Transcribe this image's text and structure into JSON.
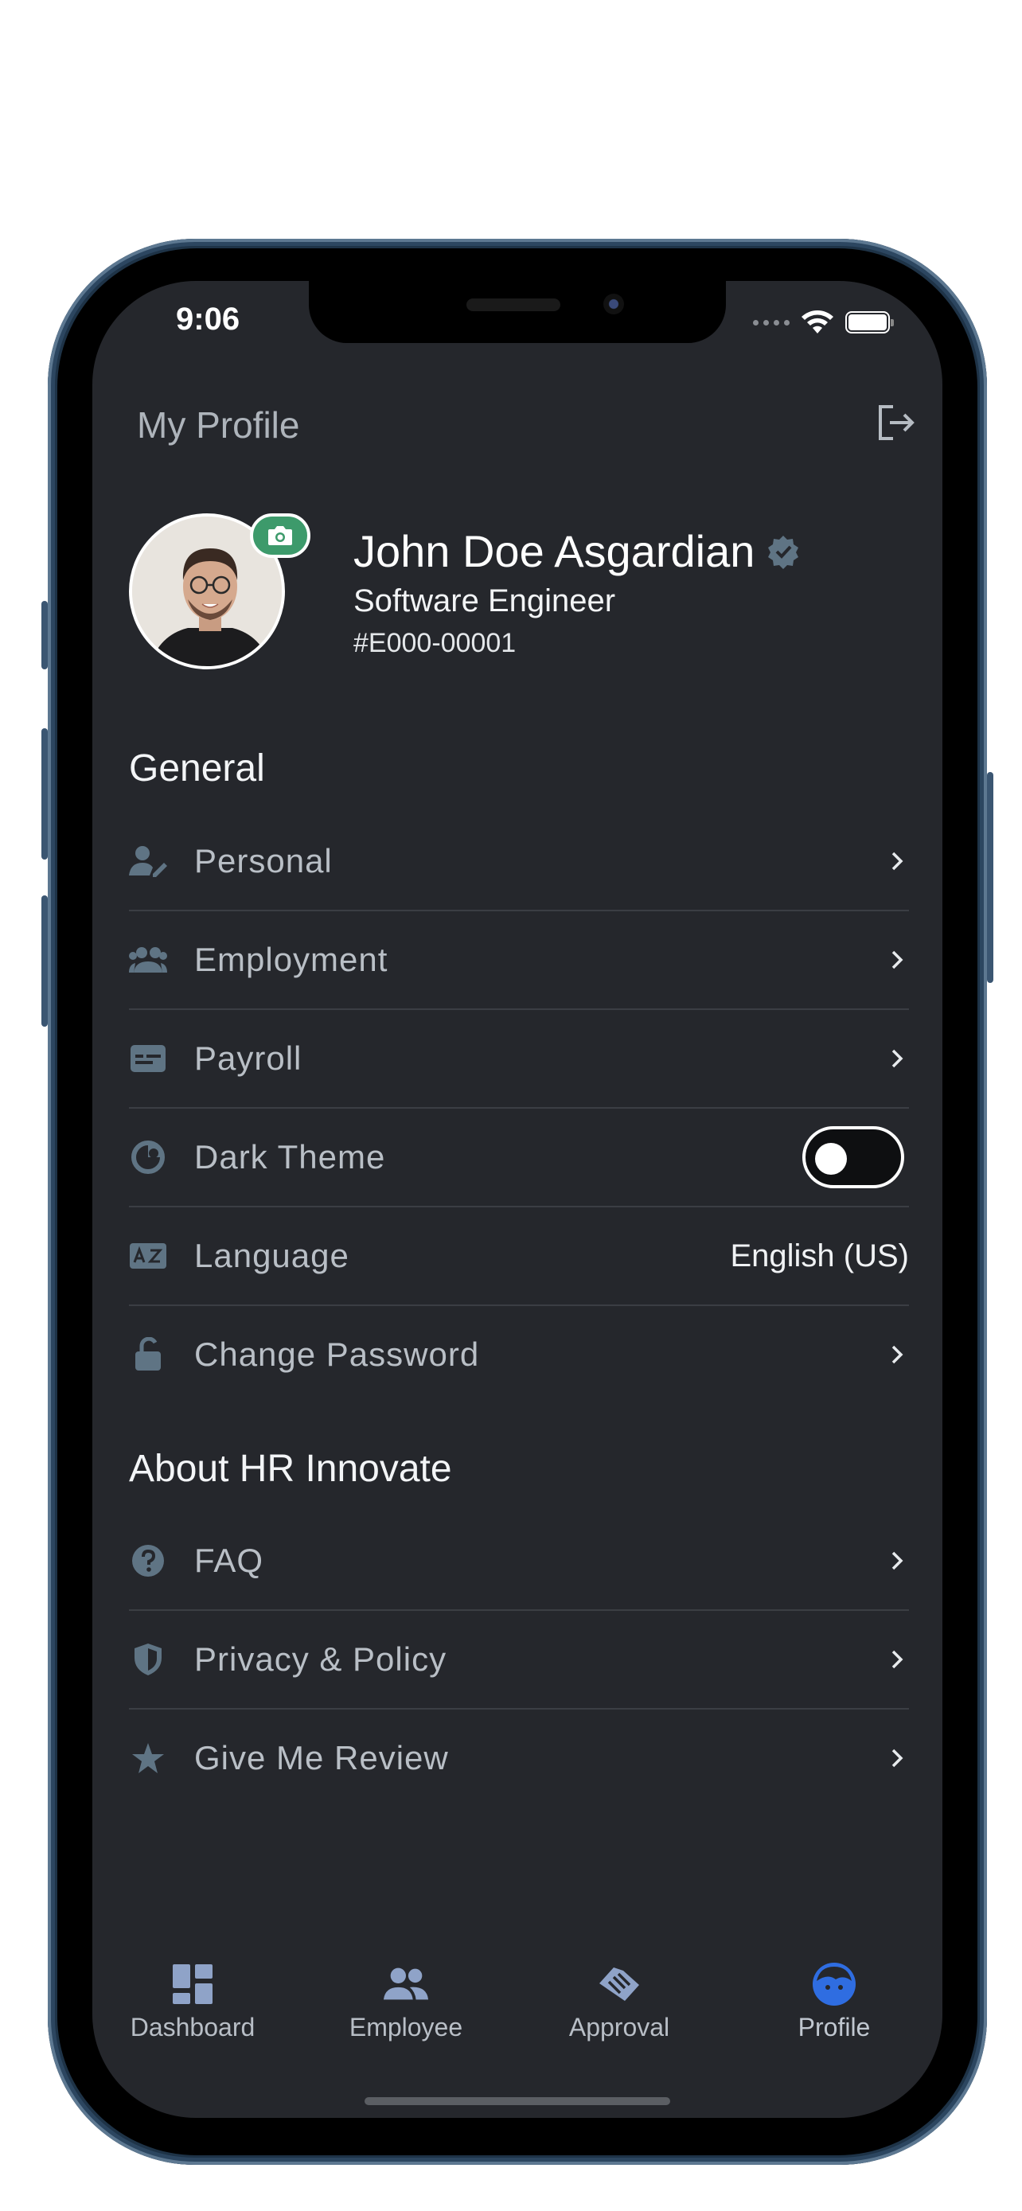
{
  "status_bar": {
    "time": "9:06"
  },
  "header": {
    "title": "My Profile"
  },
  "profile": {
    "name": "John Doe Asgardian",
    "role": "Software Engineer",
    "employee_id": "#E000-00001"
  },
  "general": {
    "title": "General",
    "items": [
      {
        "label": "Personal",
        "icon": "user-edit-icon"
      },
      {
        "label": "Employment",
        "icon": "people-group-icon"
      },
      {
        "label": "Payroll",
        "icon": "payroll-card-icon"
      },
      {
        "label": "Dark Theme",
        "icon": "theme-icon",
        "toggle": false
      },
      {
        "label": "Language",
        "icon": "language-icon",
        "value": "English (US)"
      },
      {
        "label": "Change Password",
        "icon": "lock-open-icon"
      }
    ]
  },
  "about": {
    "title": "About HR Innovate",
    "items": [
      {
        "label": "FAQ",
        "icon": "question-icon"
      },
      {
        "label": "Privacy & Policy",
        "icon": "shield-icon"
      },
      {
        "label": "Give Me Review",
        "icon": "star-icon"
      }
    ]
  },
  "bottom_nav": [
    {
      "label": "Dashboard",
      "icon": "dashboard-icon"
    },
    {
      "label": "Employee",
      "icon": "employee-icon"
    },
    {
      "label": "Approval",
      "icon": "approval-icon"
    },
    {
      "label": "Profile",
      "icon": "profile-icon",
      "active": true
    }
  ],
  "colors": {
    "background": "#25272c",
    "icon": "#5f7484",
    "accent": "#2f6de1",
    "camera_badge": "#3d9a6b"
  }
}
